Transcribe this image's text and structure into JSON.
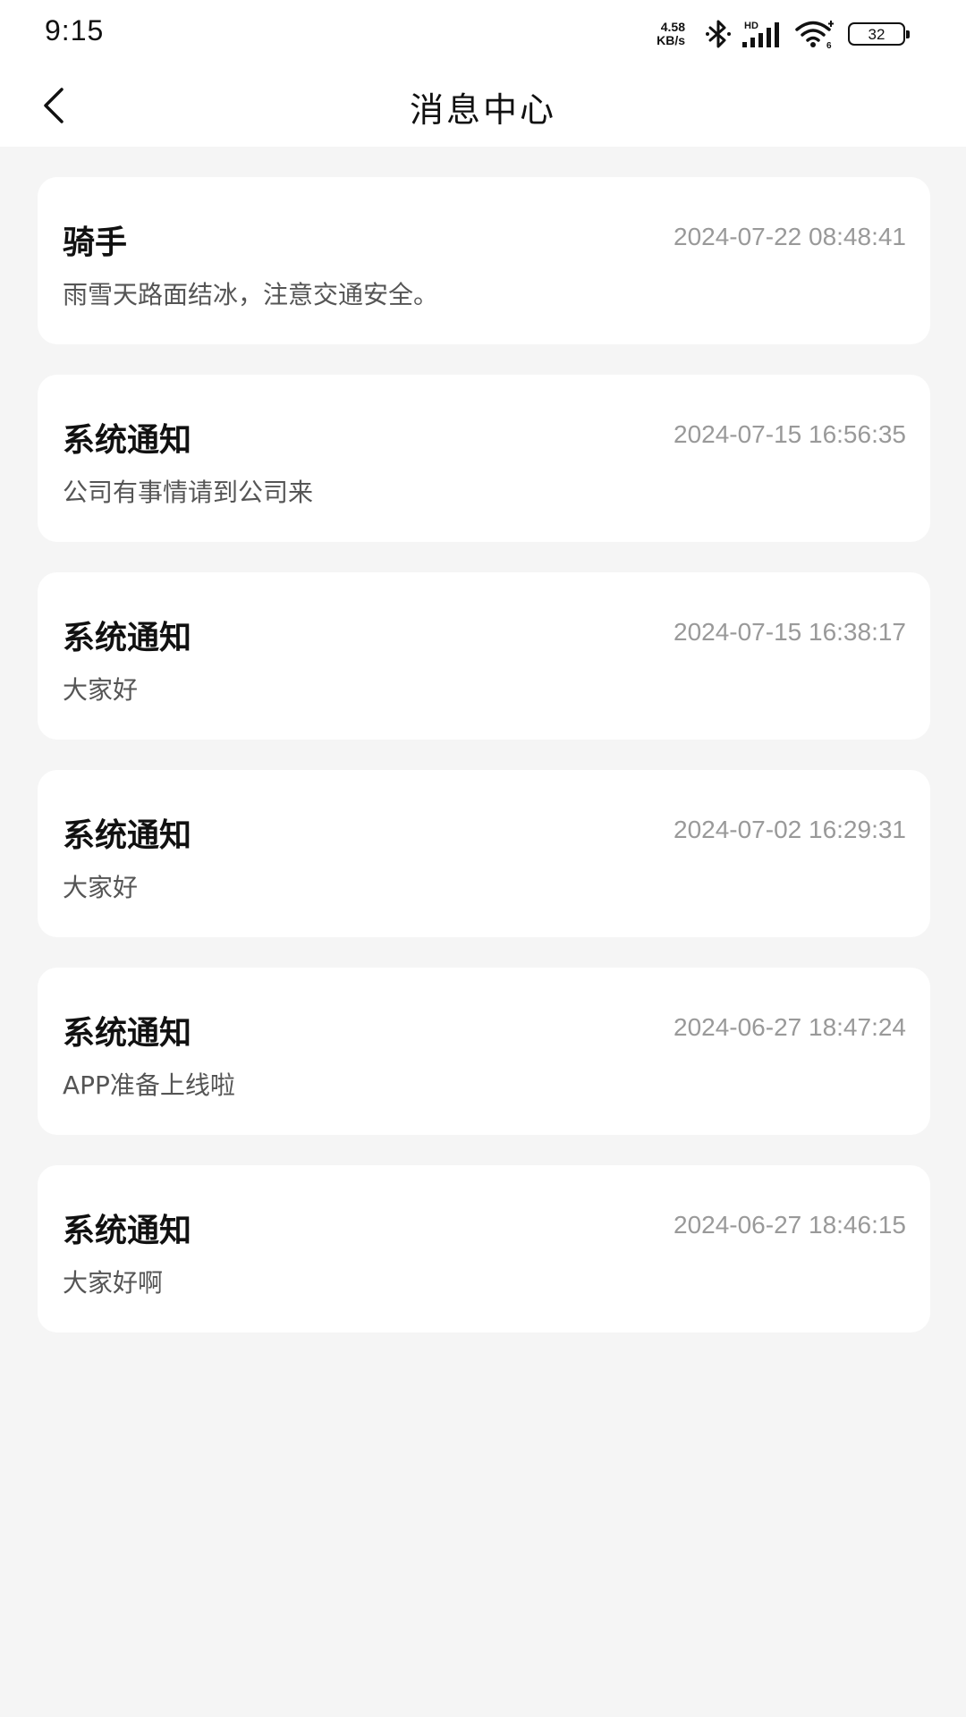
{
  "status_bar": {
    "time": "9:15",
    "net_speed_value": "4.58",
    "net_speed_unit": "KB/s",
    "signal_label": "HD",
    "battery_level": "32",
    "icons": [
      "bluetooth-icon",
      "signal-icon",
      "wifi-icon",
      "battery-icon"
    ]
  },
  "nav": {
    "title": "消息中心",
    "back_icon": "chevron-left-icon"
  },
  "messages": [
    {
      "title": "骑手",
      "time": "2024-07-22 08:48:41",
      "content": "雨雪天路面结冰，注意交通安全。"
    },
    {
      "title": "系统通知",
      "time": "2024-07-15 16:56:35",
      "content": "公司有事情请到公司来"
    },
    {
      "title": "系统通知",
      "time": "2024-07-15 16:38:17",
      "content": "大家好"
    },
    {
      "title": "系统通知",
      "time": "2024-07-02 16:29:31",
      "content": "大家好"
    },
    {
      "title": "系统通知",
      "time": "2024-06-27 18:47:24",
      "content": "APP准备上线啦"
    },
    {
      "title": "系统通知",
      "time": "2024-06-27 18:46:15",
      "content": "大家好啊"
    }
  ],
  "colors": {
    "background": "#f5f5f5",
    "card": "#ffffff",
    "title_text": "#111111",
    "time_text": "#999999",
    "body_text": "#555555"
  }
}
